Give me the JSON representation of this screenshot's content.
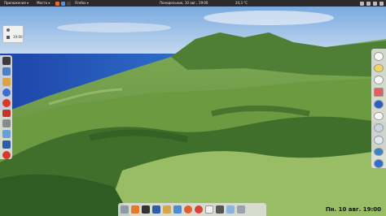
{
  "top_panel": {
    "menu_apps": "Приложения ▾",
    "menu_places": "Места ▾",
    "menu_browser": "Firefox ▾",
    "center_datetime": "Понедельник, 10 авг., 19:00",
    "right_info": "24,3 °C"
  },
  "clock_widget": {
    "time": "19:00"
  },
  "desktop_datetime": "Пн. 10 авг. 19:00",
  "colors": {
    "panel": "#2b2b2b",
    "dock": "#e6e6e6",
    "sky": "#8fb8e6",
    "sea": "#1f4fb0",
    "grass": "#7cae4a"
  },
  "left_dock_icons": [
    "terminal-icon",
    "files-icon",
    "document-icon",
    "help-icon",
    "apple-icon",
    "cherry-icon",
    "settings-icon",
    "image-icon",
    "monitor-icon",
    "power-icon"
  ],
  "right_dock_icons": [
    "clock-app-icon",
    "weather-icon",
    "gauge-icon",
    "photos-icon",
    "network-icon",
    "clock2-icon",
    "cd-icon",
    "settings2-icon",
    "update-icon",
    "system-icon"
  ],
  "bottom_dock_icons": [
    "files-icon",
    "store-icon",
    "terminal-icon",
    "virtualbox-icon",
    "folder-icon",
    "mail-icon",
    "browser-icon",
    "chrome-icon",
    "document-icon",
    "media-icon",
    "text-icon",
    "trash-icon"
  ]
}
